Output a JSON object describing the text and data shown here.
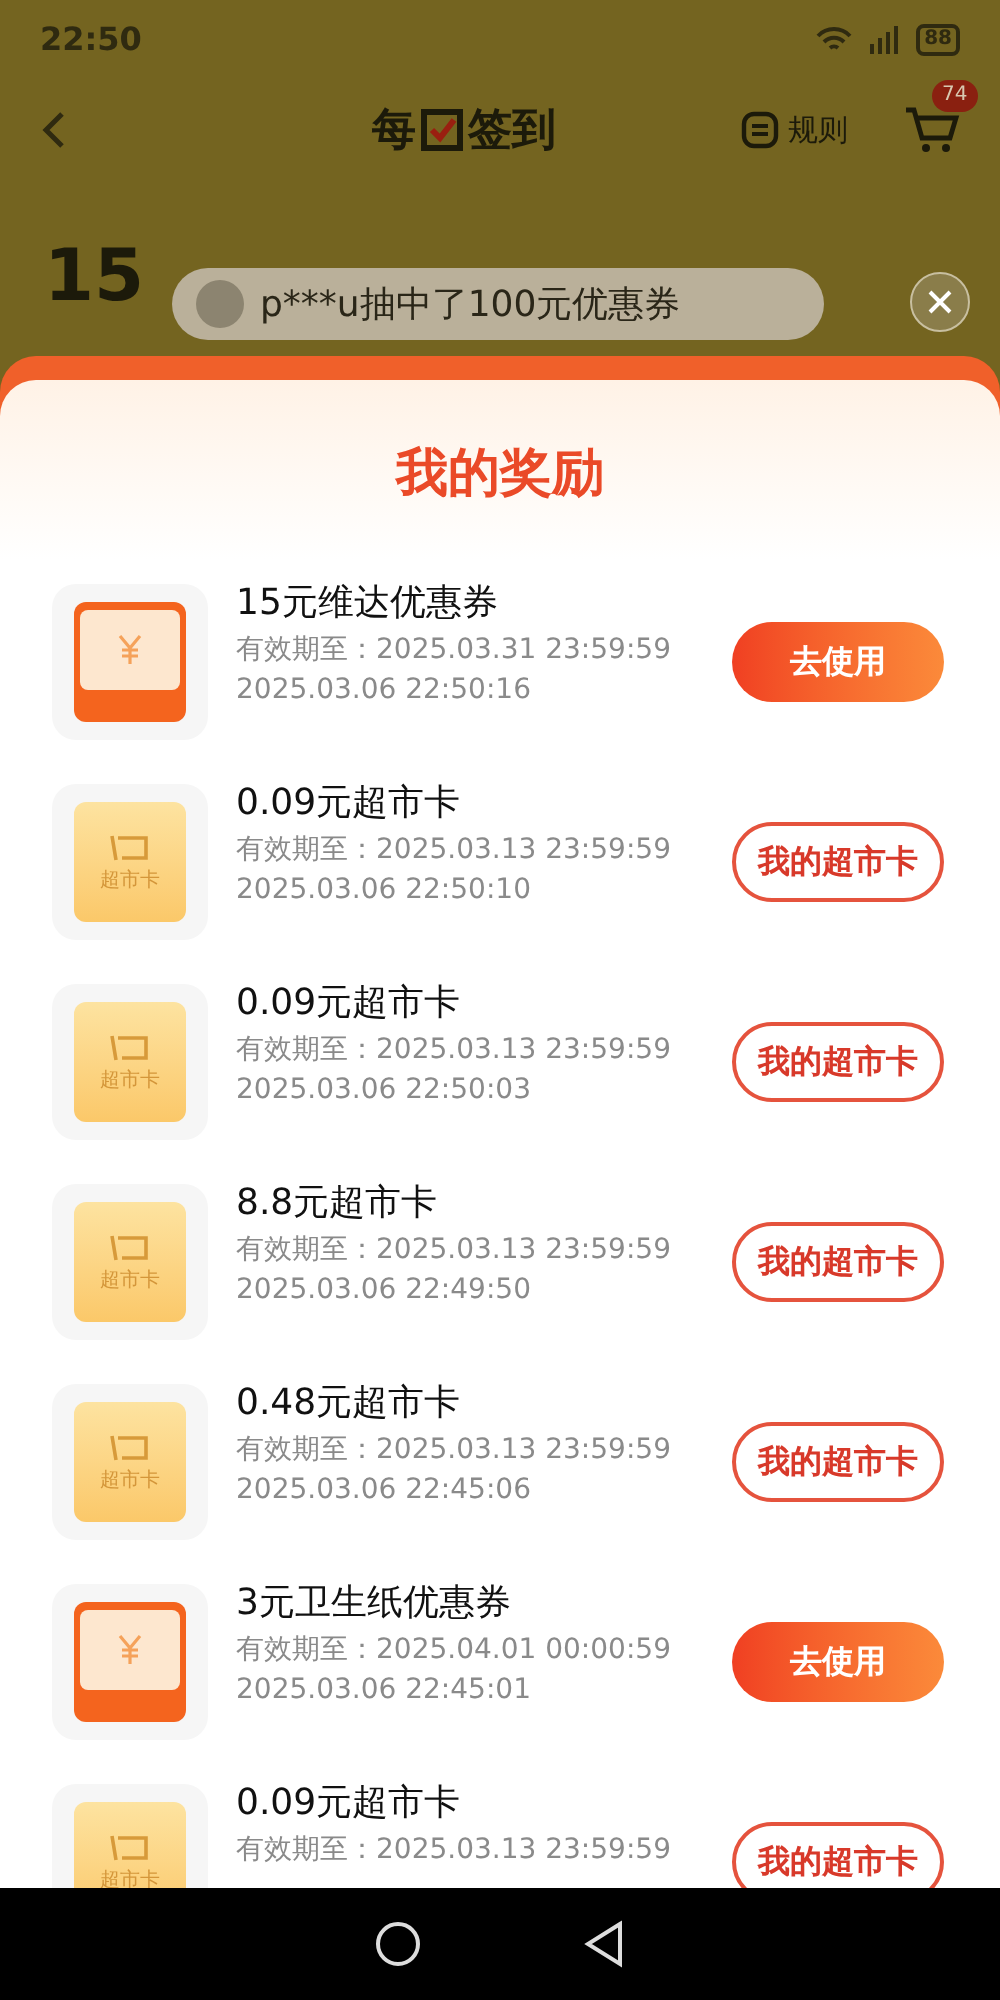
{
  "status_bar": {
    "time": "22:50",
    "battery": "88"
  },
  "header": {
    "title_parts": [
      "每",
      "签到"
    ],
    "rules": "规则",
    "cart_badge": "74"
  },
  "background": {
    "points": "15"
  },
  "toast": {
    "text": "p***u抽中了100元优惠券"
  },
  "sheet": {
    "title": "我的奖励",
    "rewards": [
      {
        "kind": "coupon",
        "name": "15元维达优惠券",
        "expiry": "有效期至：2025.03.31 23:59:59",
        "time": "2025.03.06 22:50:16",
        "action": {
          "label": "去使用",
          "kind": "primary"
        }
      },
      {
        "kind": "card",
        "icon_label": "超市卡",
        "name": "0.09元超市卡",
        "expiry": "有效期至：2025.03.13 23:59:59",
        "time": "2025.03.06 22:50:10",
        "action": {
          "label": "我的超市卡",
          "kind": "outline"
        }
      },
      {
        "kind": "card",
        "icon_label": "超市卡",
        "name": "0.09元超市卡",
        "expiry": "有效期至：2025.03.13 23:59:59",
        "time": "2025.03.06 22:50:03",
        "action": {
          "label": "我的超市卡",
          "kind": "outline"
        }
      },
      {
        "kind": "card",
        "icon_label": "超市卡",
        "name": "8.8元超市卡",
        "expiry": "有效期至：2025.03.13 23:59:59",
        "time": "2025.03.06 22:49:50",
        "action": {
          "label": "我的超市卡",
          "kind": "outline"
        }
      },
      {
        "kind": "card",
        "icon_label": "超市卡",
        "name": "0.48元超市卡",
        "expiry": "有效期至：2025.03.13 23:59:59",
        "time": "2025.03.06 22:45:06",
        "action": {
          "label": "我的超市卡",
          "kind": "outline"
        }
      },
      {
        "kind": "coupon",
        "name": "3元卫生纸优惠券",
        "expiry": "有效期至：2025.04.01 00:00:59",
        "time": "2025.03.06 22:45:01",
        "action": {
          "label": "去使用",
          "kind": "primary"
        }
      },
      {
        "kind": "card",
        "icon_label": "超市卡",
        "name": "0.09元超市卡",
        "expiry": "有效期至：2025.03.13 23:59:59",
        "action": {
          "label": "我的超市卡",
          "kind": "outline"
        }
      }
    ]
  }
}
